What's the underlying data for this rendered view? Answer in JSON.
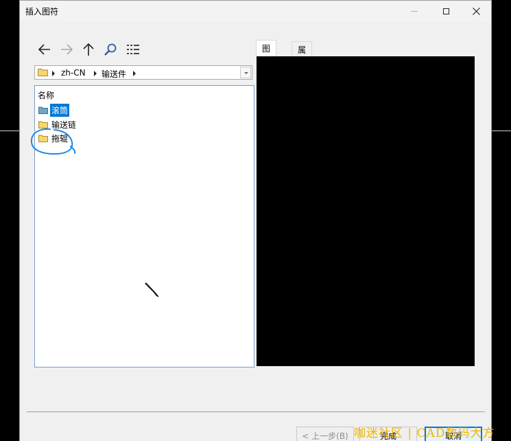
{
  "window": {
    "title": "插入图符"
  },
  "path": {
    "segments": [
      "zh-CN",
      "输送件"
    ]
  },
  "filelist": {
    "column_header": "名称",
    "items": [
      {
        "label": "滚筒",
        "selected": true
      },
      {
        "label": "输送链",
        "selected": false
      },
      {
        "label": "拖辊",
        "selected": false
      }
    ]
  },
  "tabs": [
    {
      "label": "图形",
      "active": true
    },
    {
      "label": "属性",
      "active": false
    }
  ],
  "buttons": {
    "back": "< 上一步(B)",
    "finish": "完成",
    "cancel": "取消"
  },
  "watermark": "咖迷社区 | CAD数码大方",
  "colors": {
    "selection": "#0078d7",
    "annotation": "#1e88e5",
    "watermark": "#f2b400",
    "preview_bg": "#000000"
  }
}
